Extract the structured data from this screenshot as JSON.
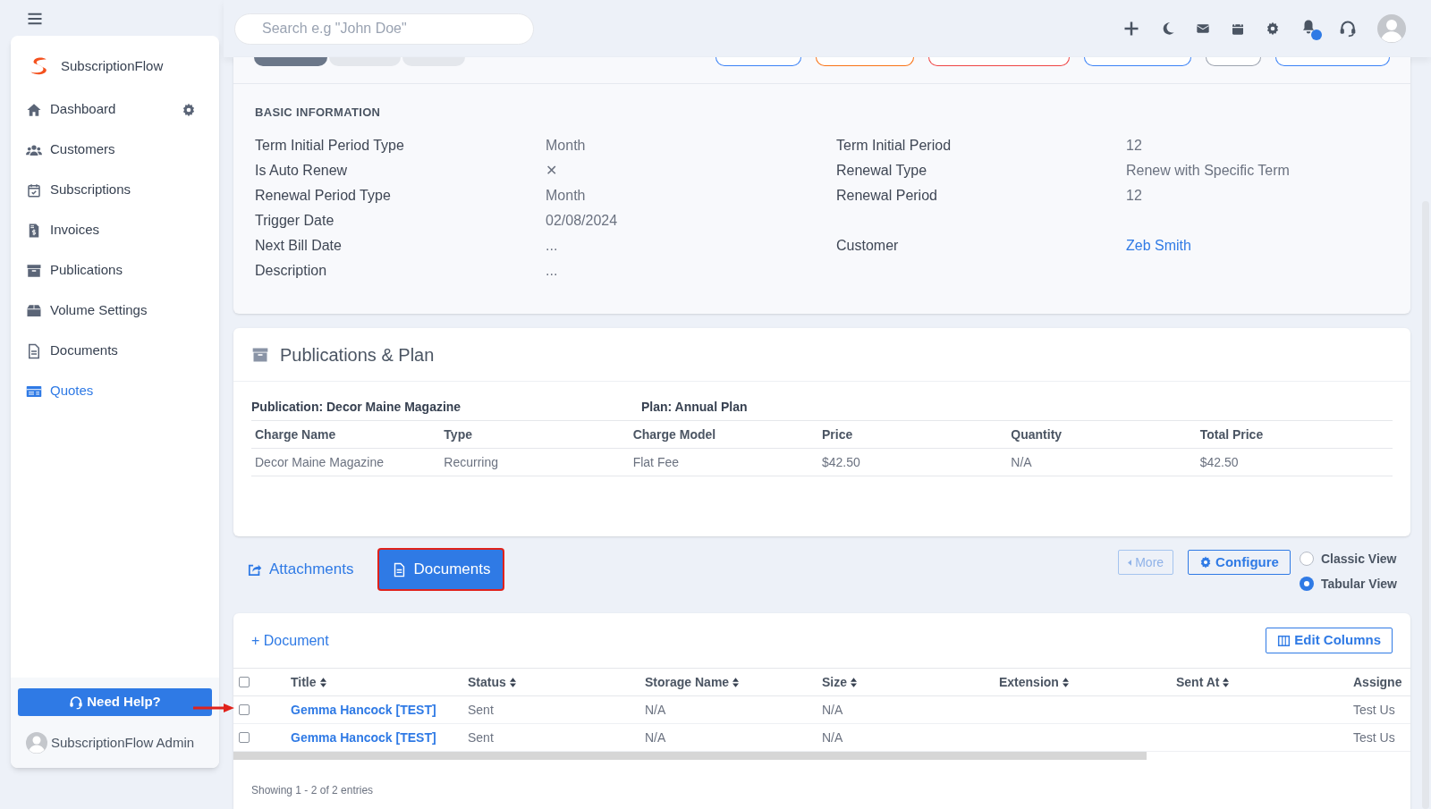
{
  "header": {
    "search_placeholder": "Search e.g \"John Doe\"",
    "notification_dot": true
  },
  "sidebar": {
    "brand": "SubscriptionFlow",
    "items": [
      {
        "label": "Dashboard",
        "selected": false,
        "settings": true
      },
      {
        "label": "Customers",
        "selected": false,
        "settings": false
      },
      {
        "label": "Subscriptions",
        "selected": false,
        "settings": false
      },
      {
        "label": "Invoices",
        "selected": false,
        "settings": false
      },
      {
        "label": "Publications",
        "selected": false,
        "settings": false
      },
      {
        "label": "Volume Settings",
        "selected": false,
        "settings": false
      },
      {
        "label": "Documents",
        "selected": false,
        "settings": false
      },
      {
        "label": "Quotes",
        "selected": true,
        "settings": false
      }
    ],
    "help_button": "Need Help?",
    "user": "SubscriptionFlow Admin"
  },
  "quote_tabs": [
    {
      "selected": true
    },
    {
      "selected": false
    },
    {
      "selected": false
    }
  ],
  "quote_actions": [
    {
      "color": "#3b82f6"
    },
    {
      "color": "#f97316"
    },
    {
      "color": "#ef4444"
    },
    {
      "color": "#3b82f6"
    },
    {
      "color": "#9ca3af"
    },
    {
      "color": "#3b82f6"
    }
  ],
  "basic_information": {
    "heading": "BASIC INFORMATION",
    "rows": [
      [
        {
          "label": "Term Initial Period Type",
          "value": "Month"
        },
        {
          "label": "Term Initial Period",
          "value": "12"
        }
      ],
      [
        {
          "label": "Is Auto Renew",
          "value": "✕"
        },
        {
          "label": "Renewal Type",
          "value": "Renew with Specific Term"
        }
      ],
      [
        {
          "label": "Renewal Period Type",
          "value": "Month"
        },
        {
          "label": "Renewal Period",
          "value": "12"
        }
      ],
      [
        {
          "label": "Trigger Date",
          "value": "02/08/2024"
        },
        null
      ],
      [
        {
          "label": "Next Bill Date",
          "value": "..."
        },
        {
          "label": "Customer",
          "value": "Zeb Smith",
          "link": true
        }
      ],
      [
        {
          "label": "Description",
          "value": "..."
        },
        null
      ]
    ]
  },
  "publications_plan": {
    "title": "Publications & Plan",
    "publication": "Publication: Decor Maine Magazine",
    "plan": "Plan: Annual Plan",
    "columns": [
      "Charge Name",
      "Type",
      "Charge Model",
      "Price",
      "Quantity",
      "Total Price"
    ],
    "rows": [
      [
        "Decor Maine Magazine",
        "Recurring",
        "Flat Fee",
        "$42.50",
        "N/A",
        "$42.50"
      ]
    ]
  },
  "section_tabs": [
    {
      "label": "Attachments",
      "selected": false,
      "highlighted": false
    },
    {
      "label": "Documents",
      "selected": true,
      "highlighted": true
    }
  ],
  "toolbar": {
    "more": "More",
    "configure": "Configure",
    "views": [
      {
        "label": "Classic View",
        "selected": false
      },
      {
        "label": "Tabular View",
        "selected": true
      }
    ]
  },
  "documents": {
    "add": "+ Document",
    "edit_columns": "Edit Columns",
    "select_all": {
      "checked": false
    },
    "columns": [
      "Title",
      "Status",
      "Storage Name",
      "Size",
      "Extension",
      "Sent At",
      "Assigne"
    ],
    "rows": [
      {
        "checked": false,
        "marked": true,
        "cells": [
          "Gemma Hancock [TEST]",
          "Sent",
          "N/A",
          "N/A",
          "",
          "",
          "Test Us"
        ]
      },
      {
        "checked": false,
        "marked": false,
        "cells": [
          "Gemma Hancock [TEST]",
          "Sent",
          "N/A",
          "N/A",
          "",
          "",
          "Test Us"
        ]
      }
    ],
    "footer": "Showing 1 - 2 of 2 entries"
  }
}
